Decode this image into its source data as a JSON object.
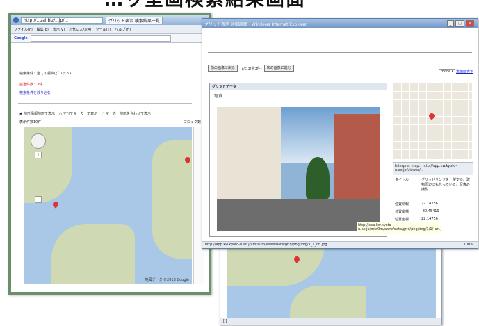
{
  "headline": "…ッ呈画検索結果画面",
  "back_window": {
    "statusbar": "[ ]"
  },
  "left_window": {
    "address": "http://...zai.biz/...jp/...",
    "tab_label": "グリッド表示 検索結果一覧",
    "menu": [
      "ファイル(F)",
      "編集(E)",
      "表示(V)",
      "お気に入り(A)",
      "ツール(T)",
      "ヘルプ(H)"
    ],
    "google": "Google",
    "search_condition": "検索条件：全ての標高(グリッド)",
    "match_count": "該当件数：3件",
    "refine_link": "検索条件を絞り込む",
    "radio_options": [
      "地形情報地形で表示",
      "すべてマーカーで表示",
      "マーカー地形を合わせて表示"
    ],
    "display_count": "表示件数10件",
    "grid_label": "ブロック数",
    "map_copyright": "地図データ ©2013 Google"
  },
  "right_window": {
    "title": "グリッド表示 詳細画面 - Windows Internet Explorer",
    "nav_buttons": [
      "前の画像に戻る",
      "次の画像に進む"
    ],
    "page_indicator": "7/c/3(全3件)",
    "select_value": "mode",
    "full_link": "全画面表示",
    "panel_header": "グリッドデータ",
    "photo_label": "写真",
    "info_header": "Interpret map：http://spp.kw.kyoto-u.ac.jp/viewer/...",
    "info_rows": [
      {
        "label": "タイトル",
        "value": "グリッドリンクを一望する。建物周辺にもなっている。写真の撮影"
      },
      {
        "label": "位置情報",
        "value": "22.14756"
      },
      {
        "label": "位置座標",
        "value": "-80.45419"
      },
      {
        "label": "位置座標",
        "value": "22.14756"
      }
    ],
    "tooltip": "http://spp.kw.kyoto-u.ac.jp/mfa0m/www/data/grid/phg/img/1/1/_on.jpg",
    "statusbar": "http://app.kw.kyoto-u.ac.jp/mfa0m/www/data/grid/phg/img/1_1_on.jpg",
    "zoom": "100%"
  }
}
